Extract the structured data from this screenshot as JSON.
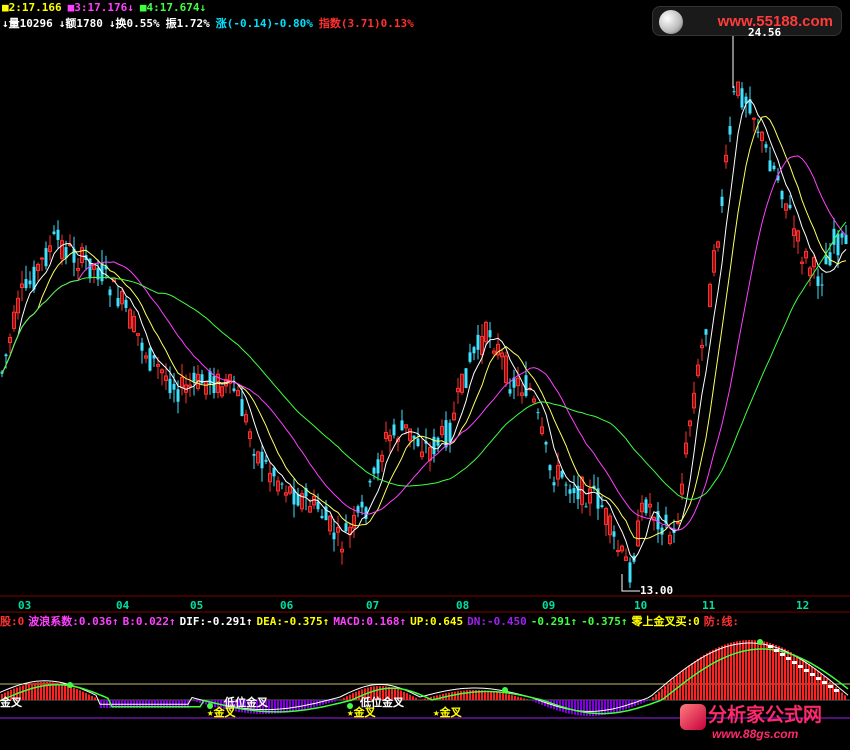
{
  "header": {
    "row1": [
      {
        "text": "■2:17.166",
        "color": "#ffff00"
      },
      {
        "text": "■3:17.176↓",
        "color": "#ff40ff"
      },
      {
        "text": "■4:17.674↓",
        "color": "#40ff40"
      }
    ],
    "row2": [
      {
        "text": "↓量10296",
        "color": "#ffffff"
      },
      {
        "text": "↓额1780",
        "color": "#ffffff"
      },
      {
        "text": "↓换0.55%",
        "color": "#ffffff"
      },
      {
        "text": "振1.72%",
        "color": "#ffffff"
      },
      {
        "text": "涨(-0.14)-0.80%",
        "color": "#00e0ff"
      },
      {
        "text": "指数(3.71)0.13%",
        "color": "#ff3030"
      }
    ]
  },
  "watermark_top": {
    "text": "www.55188.com"
  },
  "price_labels": {
    "high": "24.56",
    "low": "13.00"
  },
  "x_axis": {
    "labels": [
      "03",
      "04",
      "05",
      "06",
      "07",
      "08",
      "09",
      "10",
      "11",
      "12"
    ]
  },
  "macd_info": [
    {
      "text": "股:0",
      "color": "#ff3030"
    },
    {
      "text": "波浪系数:0.036↑",
      "color": "#ff40ff"
    },
    {
      "text": "B:0.022↑",
      "color": "#ff40ff"
    },
    {
      "text": "DIF:-0.291↑",
      "color": "#ffffff"
    },
    {
      "text": "DEA:-0.375↑",
      "color": "#ffff00"
    },
    {
      "text": "MACD:0.168↑",
      "color": "#ff40ff"
    },
    {
      "text": "UP:0.645",
      "color": "#ffff00"
    },
    {
      "text": "DN:-0.450",
      "color": "#a020f0"
    },
    {
      "text": "-0.291↑",
      "color": "#40ff40"
    },
    {
      "text": "-0.375↑",
      "color": "#40ff40"
    },
    {
      "text": "零上金叉买:0",
      "color": "#ffff00"
    },
    {
      "text": "防:线:",
      "color": "#ff3030"
    }
  ],
  "macd_labels": {
    "jincha": "金叉",
    "star_jincha": "★金叉",
    "diwei_jincha": "低位金叉"
  },
  "watermark_bottom": {
    "title": "分析家公式网",
    "url": "www.88gs.com"
  },
  "colors": {
    "up": "#ff3030",
    "down": "#40e0ff",
    "ma1": "#ffffff",
    "ma2": "#ffff60",
    "ma3": "#ff40ff",
    "ma4": "#40ff40"
  }
}
